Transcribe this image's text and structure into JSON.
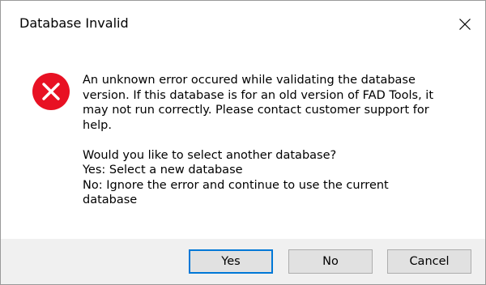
{
  "window": {
    "title": "Database Invalid",
    "close_icon": "close-icon"
  },
  "message": {
    "icon": "error-icon",
    "lines": [
      "An unknown error occured while validating the database",
      "version.  If this database is for an old version of FAD Tools, it",
      "may not run correctly.  Please contact customer support for",
      "help."
    ],
    "question_lines": [
      "Would you like to select another database?",
      "Yes: Select a new database",
      "No: Ignore the error and continue to use the current",
      "database"
    ]
  },
  "buttons": {
    "yes_label": "Yes",
    "no_label": "No",
    "cancel_label": "Cancel",
    "default": "yes"
  },
  "colors": {
    "error_red": "#e81123",
    "footer_bg": "#f0f0f0",
    "default_button_border": "#0078d7"
  }
}
